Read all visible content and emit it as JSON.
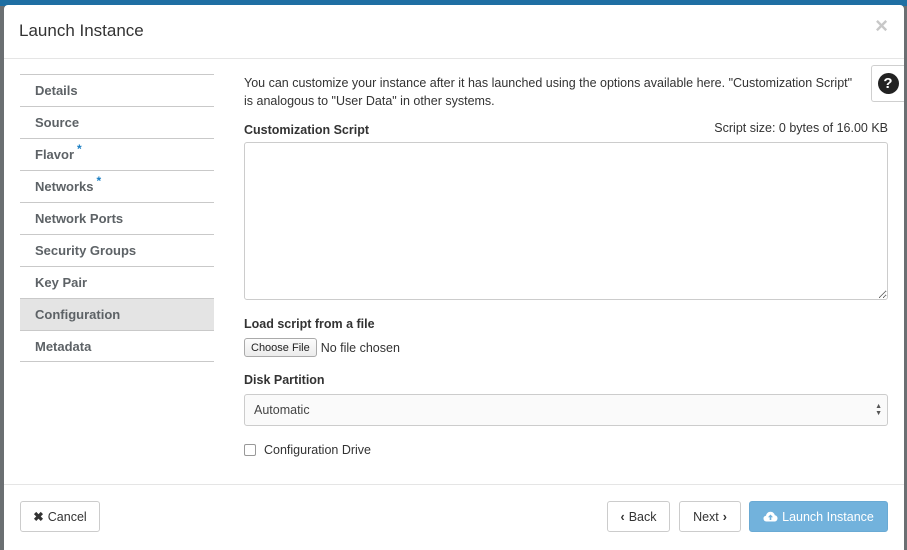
{
  "modal": {
    "title": "Launch Instance",
    "close_icon": "close-icon"
  },
  "nav": {
    "items": [
      {
        "label": "Details",
        "required": false
      },
      {
        "label": "Source",
        "required": false
      },
      {
        "label": "Flavor",
        "required": true
      },
      {
        "label": "Networks",
        "required": true
      },
      {
        "label": "Network Ports",
        "required": false
      },
      {
        "label": "Security Groups",
        "required": false
      },
      {
        "label": "Key Pair",
        "required": false
      },
      {
        "label": "Configuration",
        "required": false,
        "active": true
      },
      {
        "label": "Metadata",
        "required": false
      }
    ],
    "required_marker": "*"
  },
  "help": {
    "glyph": "?"
  },
  "content": {
    "intro_line1": "You can customize your instance after it has launched using the options available here. \"Customization Script\"",
    "intro_line2": "is analogous to \"User Data\" in other systems.",
    "script_label": "Customization Script",
    "script_size": "Script size: 0 bytes of 16.00 KB",
    "script_value": "",
    "load_label": "Load script from a file",
    "choose_file_label": "Choose File",
    "no_file_text": "No file chosen",
    "disk_label": "Disk Partition",
    "disk_value": "Automatic",
    "config_drive_label": "Configuration Drive",
    "config_drive_checked": false
  },
  "footer": {
    "cancel_label": "Cancel",
    "back_label": "Back",
    "next_label": "Next",
    "launch_label": "Launch Instance"
  },
  "colors": {
    "accent": "#1a7ec3",
    "launch_button": "#72b2dc",
    "active_nav": "#e4e4e4"
  }
}
